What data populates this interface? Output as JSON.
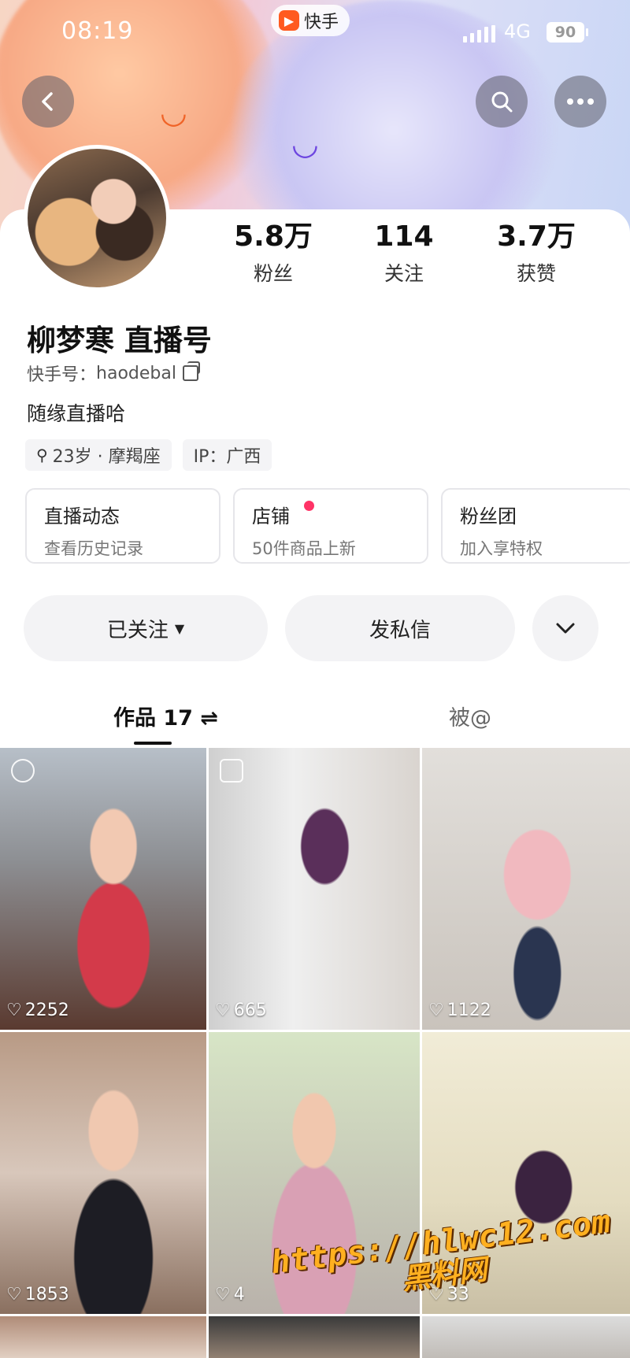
{
  "status_bar": {
    "time": "08:19",
    "app_name": "快手",
    "network": "4G",
    "battery": "90"
  },
  "nav": {
    "back_icon": "chevron-left-icon",
    "search_icon": "search-icon",
    "more_icon": "more-horizontal-icon"
  },
  "stats": [
    {
      "value": "5.8万",
      "label": "粉丝"
    },
    {
      "value": "114",
      "label": "关注"
    },
    {
      "value": "3.7万",
      "label": "获赞"
    }
  ],
  "profile": {
    "name": "柳梦寒 直播号",
    "uid_label": "快手号：",
    "uid": "haodebal",
    "bio": "随缘直播哈",
    "tags": [
      "23岁 · 摩羯座",
      "IP：广西"
    ]
  },
  "tiles": [
    {
      "title": "直播动态",
      "subtitle": "查看历史记录"
    },
    {
      "title": "店铺",
      "subtitle": "50件商品上新"
    },
    {
      "title": "粉丝团",
      "subtitle": "加入享特权"
    }
  ],
  "actions": {
    "follow": "已关注",
    "message": "发私信"
  },
  "tabs": {
    "works": "作品 17 ⇌",
    "mentions": "被@"
  },
  "grid": [
    {
      "likes": "2252"
    },
    {
      "likes": "665"
    },
    {
      "likes": "1122"
    },
    {
      "likes": "1853"
    },
    {
      "likes": "4"
    },
    {
      "likes": "33"
    }
  ],
  "watermark": {
    "line1": "https://hlwc12.com",
    "line2": "黑料网"
  },
  "colors": {
    "accent": "#ff5a1f",
    "shop_dot": "#ff3366",
    "watermark": "#ffb020"
  }
}
